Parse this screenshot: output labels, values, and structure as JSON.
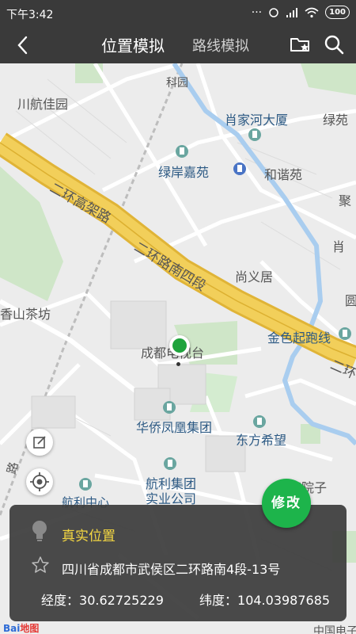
{
  "status_bar": {
    "time": "下午3:42",
    "signal_glyph": "···",
    "battery": "100"
  },
  "nav": {
    "tab_active": "位置模拟",
    "tab_inactive": "路线模拟"
  },
  "map_labels": {
    "keyuan": "科园",
    "chuanhang": "川航佳园",
    "xiaojiahe": "肖家河大厦",
    "lvyuan": "绿苑",
    "lvan": "绿岸嘉苑",
    "hexie": "和谐苑",
    "ju": "聚",
    "xiao": "肖",
    "road_gaojia": "二环高架路",
    "road_nansiduan": "二环路南四段",
    "shangyi": "尚义居",
    "yuan": "圆",
    "xiangshan": "香山茶坊",
    "jinse": "金色起跑线",
    "road_erhuan": "二环",
    "tv_tower": "成都电视台",
    "huaqiao": "华侨凤凰集团",
    "dongfang": "东方希望",
    "hangli": "航利集团",
    "shiye": "实业公司",
    "hangli_center": "航利中心",
    "yuanzi": "家院子",
    "road_left": "路",
    "zhongguo": "中国电子"
  },
  "modify_button": "修改",
  "info": {
    "title": "真实位置",
    "address": "四川省成都市武侯区二环路南4段-13号",
    "longitude_label": "经度：",
    "longitude": "30.62725229",
    "latitude_label": "纬度：",
    "latitude": "104.03987685"
  },
  "baidu": {
    "text": "Bai",
    "paw": "地图"
  },
  "colors": {
    "bar": "#3a3a3a",
    "accent_green": "#1db44b",
    "title_yellow": "#f4d742",
    "road_yellow": "#f2c94c"
  }
}
